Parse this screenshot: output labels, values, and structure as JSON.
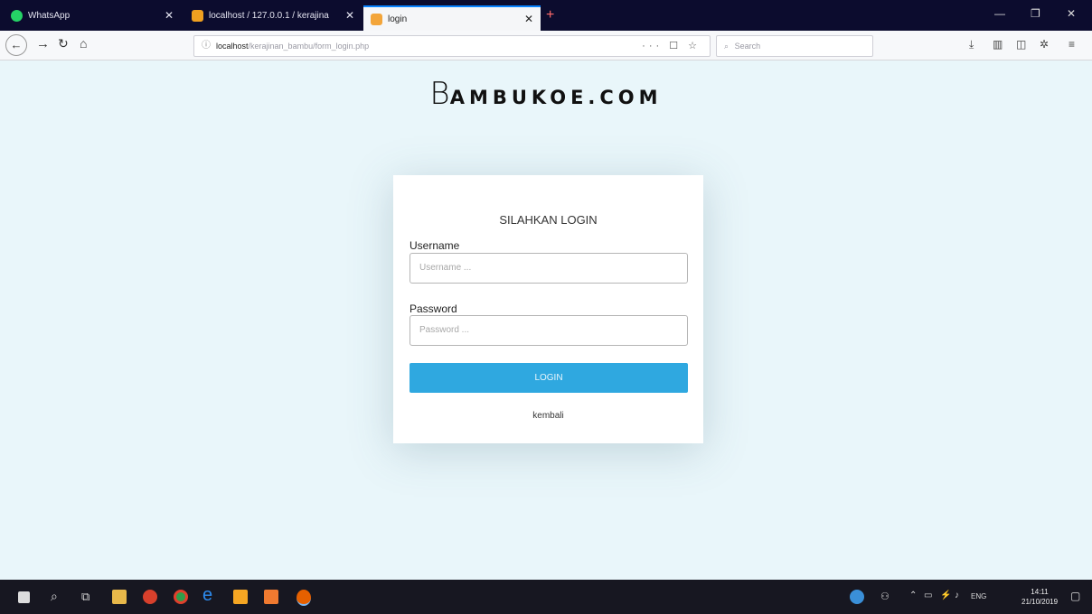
{
  "tabs": [
    {
      "label": "WhatsApp",
      "color": "#25d366"
    },
    {
      "label": "localhost / 127.0.0.1 / kerajina",
      "color": "#f0a020"
    },
    {
      "label": "login",
      "color": "#f3a53a"
    }
  ],
  "nav": {
    "url_host": "localhost",
    "url_path": "/kerajinan_bambu/form_login.php",
    "search_placeholder": "Search"
  },
  "page": {
    "logo_first": "B",
    "logo_rest": "AMBUKOE.COM",
    "card_title": "SILAHKAN LOGIN",
    "username_label": "Username",
    "username_placeholder": "Username ...",
    "password_label": "Password",
    "password_placeholder": "Password ...",
    "login_button": "LOGIN",
    "back_link": "kembali"
  },
  "taskbar": {
    "language": "ENG",
    "time": "14:11",
    "date": "21/10/2019"
  },
  "colors": {
    "accent": "#2fa8e0",
    "page_bg": "#e9f6fa",
    "tabbar_bg": "#0c0c2e"
  }
}
